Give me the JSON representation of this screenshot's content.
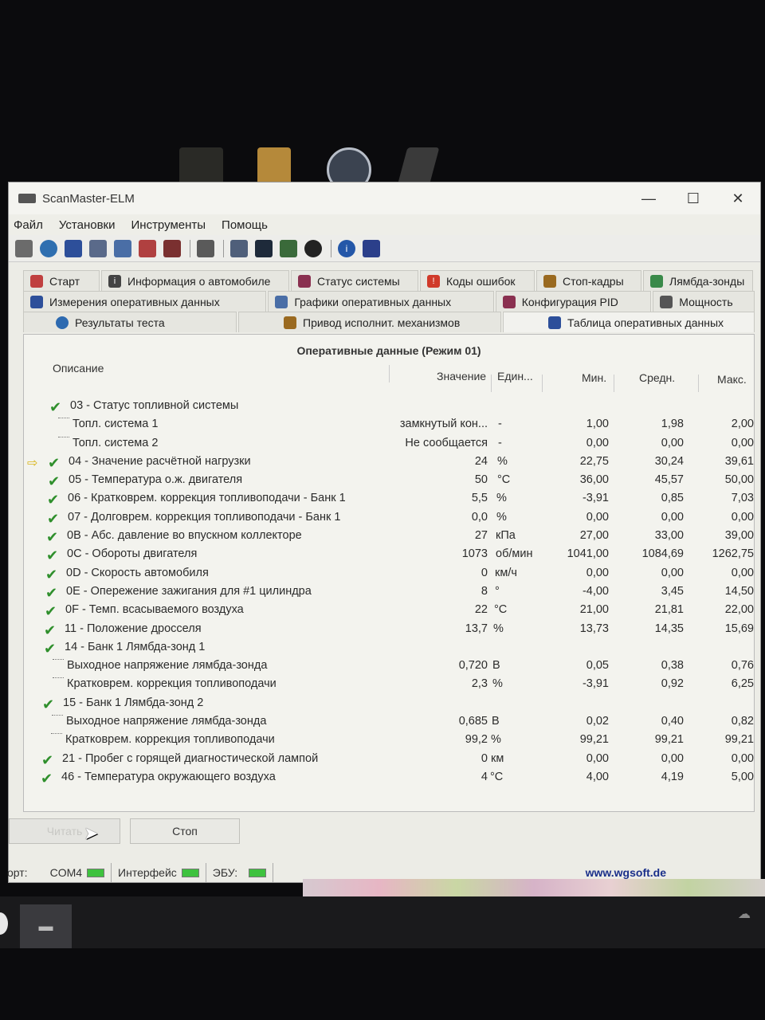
{
  "app": {
    "title": "ScanMaster-ELM"
  },
  "window_controls": {
    "minimize": "—",
    "maximize": "☐",
    "close": "✕"
  },
  "menu": [
    "Файл",
    "Установки",
    "Инструменты",
    "Помощь"
  ],
  "tabs": {
    "row1": [
      "Старт",
      "Информация о автомобиле",
      "Статус системы",
      "Коды ошибок",
      "Стоп-кадры",
      "Лямбда-зонды"
    ],
    "row2": [
      "Измерения оперативных данных",
      "Графики оперативных данных",
      "Конфигурация PID",
      "Мощность"
    ],
    "row3": [
      "Результаты теста",
      "Привод исполнит. механизмов",
      "Таблица оперативных данных"
    ]
  },
  "table": {
    "title": "Оперативные данные (Режим 01)",
    "headers": {
      "desc": "Описание",
      "value": "Значение",
      "unit": "Един...",
      "min": "Мин.",
      "avg": "Средн.",
      "max": "Макс."
    },
    "rows": [
      {
        "desc": "03 - Статус топливной системы",
        "value": "",
        "unit": "",
        "min": "",
        "avg": "",
        "max": "",
        "check": true
      },
      {
        "desc": "Топл. система 1",
        "value": "замкнутый кон...",
        "unit": "-",
        "min": "1,00",
        "avg": "1,98",
        "max": "2,00",
        "sub": true
      },
      {
        "desc": "Топл. система 2",
        "value": "Не сообщается",
        "unit": "-",
        "min": "0,00",
        "avg": "0,00",
        "max": "0,00",
        "sub": true
      },
      {
        "desc": "04 - Значение расчётной нагрузки",
        "value": "24",
        "unit": "%",
        "min": "22,75",
        "avg": "30,24",
        "max": "39,61",
        "check": true,
        "arrow": true
      },
      {
        "desc": "05 - Температура о.ж. двигателя",
        "value": "50",
        "unit": "°C",
        "min": "36,00",
        "avg": "45,57",
        "max": "50,00",
        "check": true
      },
      {
        "desc": "06 - Кратковрем. коррекция топливоподачи - Банк 1",
        "value": "5,5",
        "unit": "%",
        "min": "-3,91",
        "avg": "0,85",
        "max": "7,03",
        "check": true
      },
      {
        "desc": "07 - Долговрем. коррекция топливоподачи - Банк 1",
        "value": "0,0",
        "unit": "%",
        "min": "0,00",
        "avg": "0,00",
        "max": "0,00",
        "check": true
      },
      {
        "desc": "0B - Абс. давление во впускном коллекторе",
        "value": "27",
        "unit": "кПа",
        "min": "27,00",
        "avg": "33,00",
        "max": "39,00",
        "check": true
      },
      {
        "desc": "0C - Обороты двигателя",
        "value": "1073",
        "unit": "об/мин",
        "min": "1041,00",
        "avg": "1084,69",
        "max": "1262,75",
        "check": true
      },
      {
        "desc": "0D - Скорость автомобиля",
        "value": "0",
        "unit": "км/ч",
        "min": "0,00",
        "avg": "0,00",
        "max": "0,00",
        "check": true
      },
      {
        "desc": "0E - Опережение зажигания для #1 цилиндра",
        "value": "8",
        "unit": "°",
        "min": "-4,00",
        "avg": "3,45",
        "max": "14,50",
        "check": true
      },
      {
        "desc": "0F - Темп. всасываемого воздуха",
        "value": "22",
        "unit": "°C",
        "min": "21,00",
        "avg": "21,81",
        "max": "22,00",
        "check": true
      },
      {
        "desc": "11 - Положение дросселя",
        "value": "13,7",
        "unit": "%",
        "min": "13,73",
        "avg": "14,35",
        "max": "15,69",
        "check": true
      },
      {
        "desc": "14 - Банк 1 Лямбда-зонд 1",
        "value": "",
        "unit": "",
        "min": "",
        "avg": "",
        "max": "",
        "check": true
      },
      {
        "desc": "Выходное напряжение лямбда-зонда",
        "value": "0,720",
        "unit": "В",
        "min": "0,05",
        "avg": "0,38",
        "max": "0,76",
        "sub": true
      },
      {
        "desc": "Кратковрем. коррекция топливоподачи",
        "value": "2,3",
        "unit": "%",
        "min": "-3,91",
        "avg": "0,92",
        "max": "6,25",
        "sub": true
      },
      {
        "desc": "15 - Банк 1 Лямбда-зонд 2",
        "value": "",
        "unit": "",
        "min": "",
        "avg": "",
        "max": "",
        "check": true
      },
      {
        "desc": "Выходное напряжение лямбда-зонда",
        "value": "0,685",
        "unit": "В",
        "min": "0,02",
        "avg": "0,40",
        "max": "0,82",
        "sub": true
      },
      {
        "desc": "Кратковрем. коррекция топливоподачи",
        "value": "99,2",
        "unit": "%",
        "min": "99,21",
        "avg": "99,21",
        "max": "99,21",
        "sub": true
      },
      {
        "desc": "21 - Пробег с горящей диагностической лампой",
        "value": "0",
        "unit": "км",
        "min": "0,00",
        "avg": "0,00",
        "max": "0,00",
        "check": true
      },
      {
        "desc": "46 - Температура окружающего воздуха",
        "value": "4",
        "unit": "°C",
        "min": "4,00",
        "avg": "4,19",
        "max": "5,00",
        "check": true
      }
    ]
  },
  "buttons": {
    "read": "Читать",
    "stop": "Стоп"
  },
  "status": {
    "port_label": "орт:",
    "port_value": "COM4",
    "interface_label": "Интерфейс",
    "ecu_label": "ЭБУ:",
    "link": "www.wgsoft.de",
    "led_color": "#3ec23e"
  }
}
